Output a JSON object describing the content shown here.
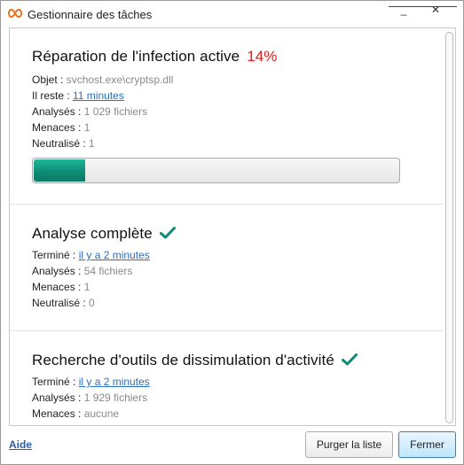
{
  "window": {
    "title": "Gestionnaire des tâches",
    "minimize_label": "_",
    "close_label": "✕"
  },
  "tasks": [
    {
      "heading": "Réparation de l'infection active",
      "percent_text": "14%",
      "progress": 0.14,
      "rows": {
        "object_label": "Objet : ",
        "object_value": "svchost.exe\\cryptsp.dll",
        "remaining_label": "Il reste : ",
        "remaining_value": "11 minutes",
        "scanned_label": "Analysés : ",
        "scanned_value": "1 029 fichiers",
        "threats_label": "Menaces : ",
        "threats_value": "1",
        "neutralized_label": "Neutralisé : ",
        "neutralized_value": " 1"
      }
    },
    {
      "heading": "Analyse complète",
      "completed": true,
      "rows": {
        "done_label": "Terminé : ",
        "done_value": "il y a 2 minutes",
        "scanned_label": "Analysés : ",
        "scanned_value": "54 fichiers",
        "threats_label": "Menaces : ",
        "threats_value": "1",
        "neutralized_label": "Neutralisé : ",
        "neutralized_value": " 0"
      }
    },
    {
      "heading": "Recherche d'outils de dissimulation d'activité",
      "completed": true,
      "rows": {
        "done_label": "Terminé : ",
        "done_value": "il y a 2 minutes",
        "scanned_label": "Analysés : ",
        "scanned_value": "1 929 fichiers",
        "threats_label": "Menaces : ",
        "threats_value": "aucune"
      }
    }
  ],
  "footer": {
    "help_label": "Aide",
    "purge_label": "Purger la liste",
    "close_label": "Fermer"
  },
  "colors": {
    "accent_teal": "#0f8c78",
    "percent_red": "#e01818",
    "link_blue": "#2a6fc0"
  },
  "icons": {
    "app": "infinity-logo-icon",
    "completed": "check-icon"
  }
}
